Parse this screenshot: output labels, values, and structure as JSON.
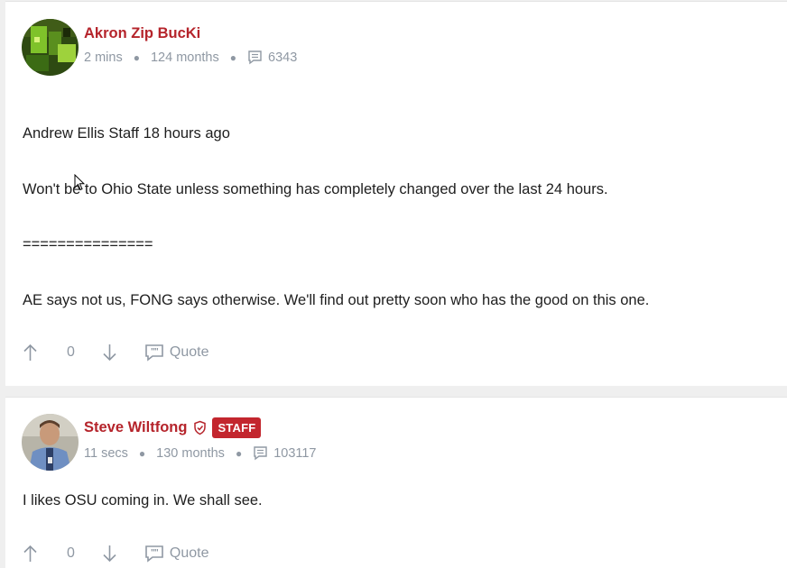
{
  "posts": [
    {
      "author": "Akron Zip BucKi",
      "staff_badge": "",
      "last_seen": "2 mins",
      "membership": "124 months",
      "post_count": "6343",
      "body": [
        "Andrew Ellis Staff 18 hours ago",
        "Won't be to Ohio State unless something has completely changed over the last 24 hours.",
        "===============",
        "AE says not us, FONG says otherwise. We'll find out pretty soon who has the good on this one."
      ],
      "votes": "0",
      "quote_label": "Quote"
    },
    {
      "author": "Steve Wiltfong",
      "staff_badge": "STAFF",
      "last_seen": "11 secs",
      "membership": "130 months",
      "post_count": "103117",
      "body": [
        "I likes OSU coming in. We shall see."
      ],
      "votes": "0",
      "quote_label": "Quote"
    }
  ],
  "colors": {
    "author": "#b5242b",
    "staff_badge": "#c3262e",
    "meta": "#8f98a3",
    "body": "#1e1e1e",
    "background": "#efefef"
  },
  "icons": {
    "posts": "speech-bubble-icon",
    "upvote": "arrow-up-icon",
    "downvote": "arrow-down-icon",
    "quote": "quote-bubble-icon",
    "verified": "shield-icon"
  }
}
